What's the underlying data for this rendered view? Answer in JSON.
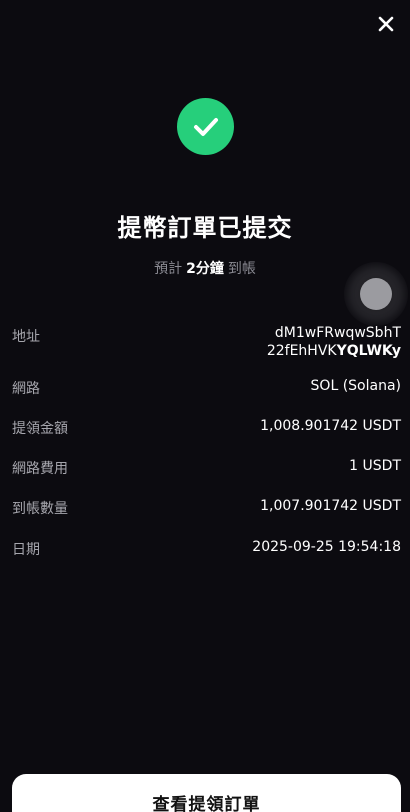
{
  "header": {
    "close_icon": "close-icon"
  },
  "status": {
    "icon": "checkmark-icon",
    "accent_color": "#26cf7b",
    "title": "提幣訂單已提交",
    "eta_prefix": "預計",
    "eta_value": "2分鐘",
    "eta_suffix": "到帳"
  },
  "details": {
    "address_label": "地址",
    "address_line1": "dM1wFRwqwSbhT",
    "address_line2_prefix": "22fEhHVK",
    "address_line2_bold": "YQLWKy",
    "network_label": "網路",
    "network_value": "SOL (Solana)",
    "amount_label": "提領金額",
    "amount_value": "1,008.901742 USDT",
    "fee_label": "網路費用",
    "fee_value": "1 USDT",
    "received_label": "到帳數量",
    "received_value": "1,007.901742 USDT",
    "date_label": "日期",
    "date_value": "2025-09-25 19:54:18"
  },
  "actions": {
    "view_orders_label": "查看提領訂單"
  }
}
